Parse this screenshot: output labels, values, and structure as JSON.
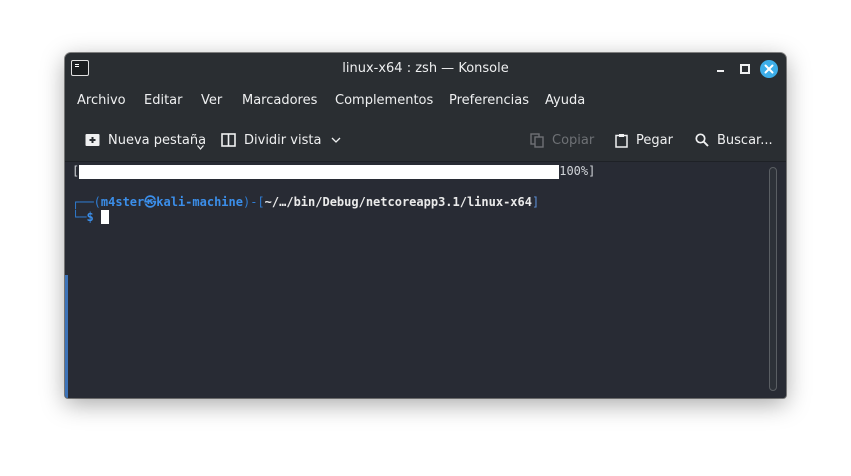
{
  "window": {
    "title": "linux-x64 : zsh — Konsole"
  },
  "menubar": {
    "items": [
      "Archivo",
      "Editar",
      "Ver",
      "Marcadores",
      "Complementos",
      "Preferencias",
      "Ayuda"
    ]
  },
  "toolbar": {
    "new_tab": "Nueva pestaña",
    "split_view": "Dividir vista",
    "copy": "Copiar",
    "paste": "Pegar",
    "search": "Buscar..."
  },
  "terminal": {
    "progress_open": "[",
    "progress_percent": "100%]",
    "progress_value": 1.0,
    "prompt_top_prefix": "┌──(",
    "user": "m4ster",
    "at_symbol": "㉿",
    "host": "kali-machine",
    "mid": ")-[",
    "path": "~/…/bin/Debug/netcoreapp3.1/linux-x64",
    "close_bracket": "]",
    "prompt_bottom_prefix": "└─",
    "prompt_symbol": "$"
  },
  "colors": {
    "window_bg": "#2a2e32",
    "terminal_bg": "#282b34",
    "accent": "#3daee9",
    "prompt_blue": "#3b8ee9"
  },
  "icons": [
    "terminal-app-icon",
    "minimize-icon",
    "maximize-icon",
    "close-icon",
    "new-tab-icon",
    "split-view-icon",
    "chevron-down-icon",
    "copy-icon",
    "paste-icon",
    "search-icon"
  ]
}
